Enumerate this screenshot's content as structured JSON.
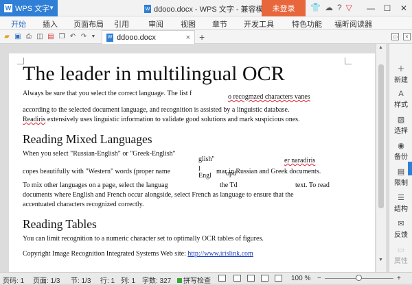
{
  "titlebar": {
    "app_name": "WPS 文字",
    "app_logo": "W",
    "window_title": "ddooo.docx - WPS 文字 - 兼容模式",
    "login_label": "未登录",
    "icons": [
      "shirt-icon",
      "cloud-icon",
      "help-icon",
      "brand-icon"
    ],
    "help_glyph": "?"
  },
  "menubar": {
    "tabs": [
      "开始",
      "插入",
      "页面布局",
      "引用",
      "审阅",
      "视图",
      "章节",
      "开发工具",
      "特色功能",
      "福昕阅读器"
    ],
    "active_tab": "开始"
  },
  "toolbar": {
    "doc_tab_label": "ddooo.docx",
    "close_glyph": "×",
    "add_glyph": "+",
    "quick_icons": [
      "open-icon",
      "save-icon",
      "print-icon",
      "print-preview-icon",
      "export-pdf-icon",
      "copy-format-icon",
      "undo-icon",
      "redo-icon"
    ]
  },
  "document": {
    "heading": "The leader in multilingual OCR",
    "p1_part1": "Always be sure that you select the correct language. The list f",
    "p1_part2": "o recogmzed characters vanes",
    "p1_line2": "according to the selected document language, and recognition is assisted by a linguistic database.",
    "p1_line3a": "Readiris",
    "p1_line3b": " extensively uses linguistic information to validate good solutions and mark suspicious ones.",
    "h2_mixed": "Reading Mixed Languages",
    "p2_part1": "When you select \"Russian-English\" or \"Greek-English\"",
    "p2_frag_glish": "glish\"",
    "p2_frag_naradiris": "er naradiris",
    "p2_line2a": "copes beautifully with \"Western\" words (proper name",
    "p2_frag_l": "l",
    "p2_frag_mar": "mar in Russian and Greek documents.",
    "p2_frag_engl": "Engl",
    "p2_frag_opd": "opd",
    "p3_line1a": "To mix other languages on a page, select the languag",
    "p3_line1b": "the Td",
    "p3_line1c": "text. To read",
    "p3_line2": "documents where English and French occur alongside, select French as language to ensure that the",
    "p3_line3": "accentuated characters recognized correctly.",
    "h2_tables": "Reading Tables",
    "p4": "You can limit recognition to a numeric character set to optimally OCR tables of figures.",
    "p5_text": "Copyright Image Recognition Integrated Systems Web site: ",
    "p5_link": "http://www.irislink.com"
  },
  "sidebar": {
    "items": [
      {
        "label": "新建",
        "icon": "new-icon",
        "glyph": "＋"
      },
      {
        "label": "样式",
        "icon": "style-icon",
        "glyph": "A"
      },
      {
        "label": "选择",
        "icon": "select-icon",
        "glyph": "▧"
      },
      {
        "label": "备份",
        "icon": "backup-icon",
        "glyph": "◉"
      },
      {
        "label": "限制",
        "icon": "restrict-icon",
        "glyph": "▤"
      },
      {
        "label": "结构",
        "icon": "structure-icon",
        "glyph": "☰"
      },
      {
        "label": "反馈",
        "icon": "feedback-icon",
        "glyph": "✉"
      },
      {
        "label": "属性",
        "icon": "properties-icon",
        "glyph": "▭",
        "disabled": true
      }
    ]
  },
  "statusbar": {
    "page_number": "页码: 1",
    "page_count": "页面: 1/3",
    "section": "节: 1/3",
    "row": "行: 1",
    "column": "列: 1",
    "word_count": "字数: 327",
    "spell_check": "拼写检查",
    "zoom": "100 %",
    "zoom_level": 1.0,
    "zoom_minus": "−",
    "zoom_plus": "+"
  },
  "colors": {
    "accent": "#2f7fd6",
    "login": "#e8663c",
    "active_tab": "#2f6fc2"
  }
}
